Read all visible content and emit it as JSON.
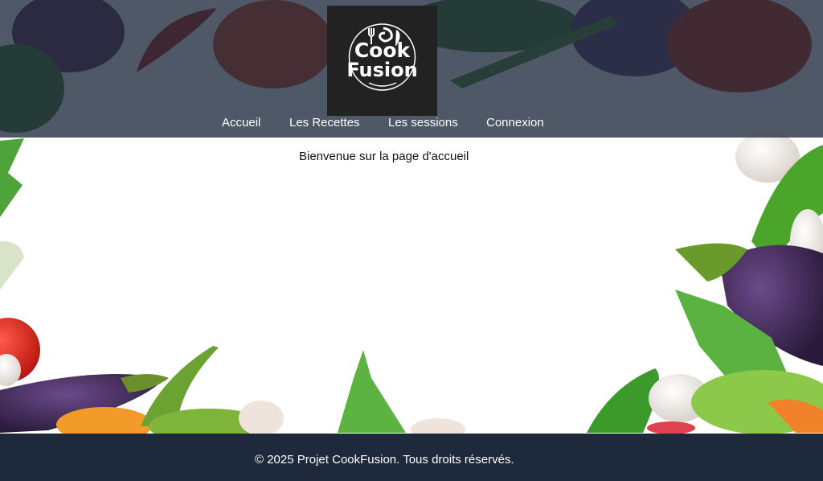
{
  "app": {
    "logo": {
      "line1": "Cook",
      "line2": "Fusion"
    }
  },
  "nav": {
    "items": [
      "Accueil",
      "Les Recettes",
      "Les sessions",
      "Connexion"
    ]
  },
  "main": {
    "welcome": "Bienvenue sur la page d'accueil"
  },
  "footer": {
    "copyright": "© 2025 Projet CookFusion. Tous droits réservés."
  },
  "colors": {
    "header_overlay": "#1e293b",
    "footer_bg": "#1e293b",
    "logo_bg": "#222222"
  }
}
